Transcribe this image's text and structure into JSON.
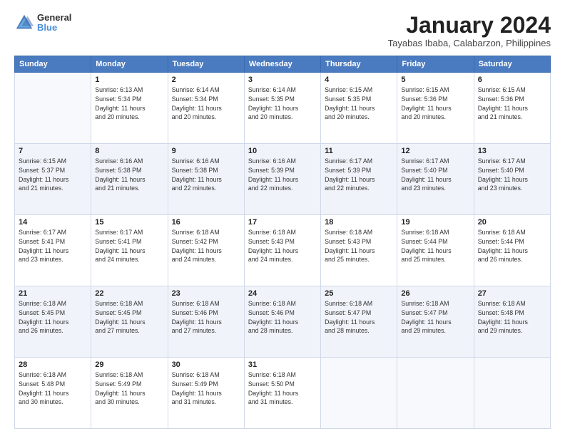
{
  "logo": {
    "line1": "General",
    "line2": "Blue"
  },
  "title": "January 2024",
  "subtitle": "Tayabas Ibaba, Calabarzon, Philippines",
  "days_header": [
    "Sunday",
    "Monday",
    "Tuesday",
    "Wednesday",
    "Thursday",
    "Friday",
    "Saturday"
  ],
  "weeks": [
    [
      {
        "day": "",
        "info": ""
      },
      {
        "day": "1",
        "info": "Sunrise: 6:13 AM\nSunset: 5:34 PM\nDaylight: 11 hours\nand 20 minutes."
      },
      {
        "day": "2",
        "info": "Sunrise: 6:14 AM\nSunset: 5:34 PM\nDaylight: 11 hours\nand 20 minutes."
      },
      {
        "day": "3",
        "info": "Sunrise: 6:14 AM\nSunset: 5:35 PM\nDaylight: 11 hours\nand 20 minutes."
      },
      {
        "day": "4",
        "info": "Sunrise: 6:15 AM\nSunset: 5:35 PM\nDaylight: 11 hours\nand 20 minutes."
      },
      {
        "day": "5",
        "info": "Sunrise: 6:15 AM\nSunset: 5:36 PM\nDaylight: 11 hours\nand 20 minutes."
      },
      {
        "day": "6",
        "info": "Sunrise: 6:15 AM\nSunset: 5:36 PM\nDaylight: 11 hours\nand 21 minutes."
      }
    ],
    [
      {
        "day": "7",
        "info": "Sunrise: 6:15 AM\nSunset: 5:37 PM\nDaylight: 11 hours\nand 21 minutes."
      },
      {
        "day": "8",
        "info": "Sunrise: 6:16 AM\nSunset: 5:38 PM\nDaylight: 11 hours\nand 21 minutes."
      },
      {
        "day": "9",
        "info": "Sunrise: 6:16 AM\nSunset: 5:38 PM\nDaylight: 11 hours\nand 22 minutes."
      },
      {
        "day": "10",
        "info": "Sunrise: 6:16 AM\nSunset: 5:39 PM\nDaylight: 11 hours\nand 22 minutes."
      },
      {
        "day": "11",
        "info": "Sunrise: 6:17 AM\nSunset: 5:39 PM\nDaylight: 11 hours\nand 22 minutes."
      },
      {
        "day": "12",
        "info": "Sunrise: 6:17 AM\nSunset: 5:40 PM\nDaylight: 11 hours\nand 23 minutes."
      },
      {
        "day": "13",
        "info": "Sunrise: 6:17 AM\nSunset: 5:40 PM\nDaylight: 11 hours\nand 23 minutes."
      }
    ],
    [
      {
        "day": "14",
        "info": "Sunrise: 6:17 AM\nSunset: 5:41 PM\nDaylight: 11 hours\nand 23 minutes."
      },
      {
        "day": "15",
        "info": "Sunrise: 6:17 AM\nSunset: 5:41 PM\nDaylight: 11 hours\nand 24 minutes."
      },
      {
        "day": "16",
        "info": "Sunrise: 6:18 AM\nSunset: 5:42 PM\nDaylight: 11 hours\nand 24 minutes."
      },
      {
        "day": "17",
        "info": "Sunrise: 6:18 AM\nSunset: 5:43 PM\nDaylight: 11 hours\nand 24 minutes."
      },
      {
        "day": "18",
        "info": "Sunrise: 6:18 AM\nSunset: 5:43 PM\nDaylight: 11 hours\nand 25 minutes."
      },
      {
        "day": "19",
        "info": "Sunrise: 6:18 AM\nSunset: 5:44 PM\nDaylight: 11 hours\nand 25 minutes."
      },
      {
        "day": "20",
        "info": "Sunrise: 6:18 AM\nSunset: 5:44 PM\nDaylight: 11 hours\nand 26 minutes."
      }
    ],
    [
      {
        "day": "21",
        "info": "Sunrise: 6:18 AM\nSunset: 5:45 PM\nDaylight: 11 hours\nand 26 minutes."
      },
      {
        "day": "22",
        "info": "Sunrise: 6:18 AM\nSunset: 5:45 PM\nDaylight: 11 hours\nand 27 minutes."
      },
      {
        "day": "23",
        "info": "Sunrise: 6:18 AM\nSunset: 5:46 PM\nDaylight: 11 hours\nand 27 minutes."
      },
      {
        "day": "24",
        "info": "Sunrise: 6:18 AM\nSunset: 5:46 PM\nDaylight: 11 hours\nand 28 minutes."
      },
      {
        "day": "25",
        "info": "Sunrise: 6:18 AM\nSunset: 5:47 PM\nDaylight: 11 hours\nand 28 minutes."
      },
      {
        "day": "26",
        "info": "Sunrise: 6:18 AM\nSunset: 5:47 PM\nDaylight: 11 hours\nand 29 minutes."
      },
      {
        "day": "27",
        "info": "Sunrise: 6:18 AM\nSunset: 5:48 PM\nDaylight: 11 hours\nand 29 minutes."
      }
    ],
    [
      {
        "day": "28",
        "info": "Sunrise: 6:18 AM\nSunset: 5:48 PM\nDaylight: 11 hours\nand 30 minutes."
      },
      {
        "day": "29",
        "info": "Sunrise: 6:18 AM\nSunset: 5:49 PM\nDaylight: 11 hours\nand 30 minutes."
      },
      {
        "day": "30",
        "info": "Sunrise: 6:18 AM\nSunset: 5:49 PM\nDaylight: 11 hours\nand 31 minutes."
      },
      {
        "day": "31",
        "info": "Sunrise: 6:18 AM\nSunset: 5:50 PM\nDaylight: 11 hours\nand 31 minutes."
      },
      {
        "day": "",
        "info": ""
      },
      {
        "day": "",
        "info": ""
      },
      {
        "day": "",
        "info": ""
      }
    ]
  ]
}
